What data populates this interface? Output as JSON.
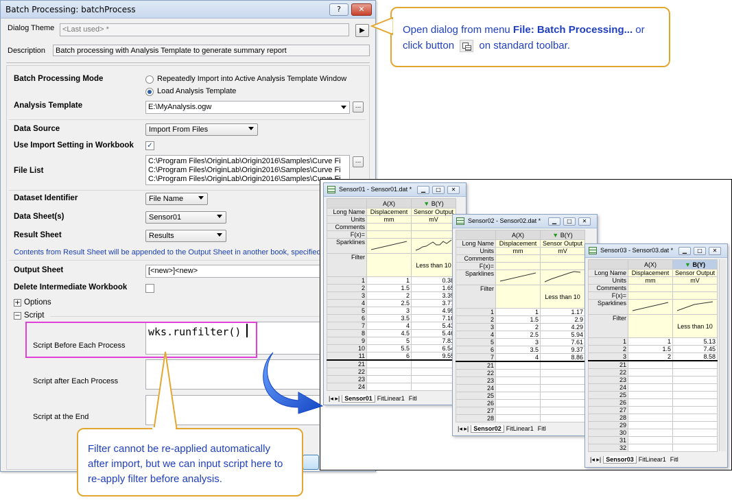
{
  "dialog": {
    "title": "Batch Processing: batchProcess",
    "help_btn": "?",
    "close_btn": "✕",
    "theme_label": "Dialog Theme",
    "theme_value": "<Last used> *",
    "description_label": "Description",
    "description_value": "Batch processing with Analysis Template to generate summary report",
    "mode_label": "Batch Processing Mode",
    "mode_opt1": "Repeatedly Import into Active Analysis Template Window",
    "mode_opt2": "Load Analysis Template",
    "template_label": "Analysis Template",
    "template_value": "E:\\MyAnalysis.ogw",
    "source_label": "Data Source",
    "source_value": "Import From Files",
    "import_setting_label": "Use Import Setting in Workbook",
    "filelist_label": "File List",
    "files": [
      "C:\\Program Files\\OriginLab\\Origin2016\\Samples\\Curve Fi",
      "C:\\Program Files\\OriginLab\\Origin2016\\Samples\\Curve Fi",
      "C:\\Program Files\\OriginLab\\Origin2016\\Samples\\Curve Fi"
    ],
    "dataset_id_label": "Dataset Identifier",
    "dataset_id_value": "File Name",
    "datasheet_label": "Data Sheet(s)",
    "datasheet_value": "Sensor01",
    "result_label": "Result Sheet",
    "result_value": "Results",
    "result_note": "Contents from Result Sheet will be appended to the Output Sheet in another book, specified be",
    "output_label": "Output Sheet",
    "output_value": "[<new>]<new>",
    "delete_label": "Delete Intermediate Workbook",
    "options_label": "Options",
    "script_label": "Script",
    "script_before_label": "Script Before Each Process",
    "script_before_value": "wks.runfilter()",
    "script_after_label": "Script after Each Process",
    "script_end_label": "Script at the End"
  },
  "callout_top": {
    "line1_pre": "Open dialog from menu ",
    "line1_bold": "File: Batch Processing...",
    "line1_post": " or",
    "line2_pre": "click button ",
    "line2_post": " on standard toolbar."
  },
  "callout_bottom": {
    "text": "Filter cannot be re-applied automatically after import, but we can input script here to re-apply filter before analysis."
  },
  "worksheets": [
    {
      "title": "Sensor01 - Sensor01.dat *",
      "filter_text": "Less than 10",
      "rows": [
        [
          "1",
          "1",
          "0.38"
        ],
        [
          "2",
          "1.5",
          "1.65"
        ],
        [
          "3",
          "2",
          "3.39"
        ],
        [
          "4",
          "2.5",
          "3.77"
        ],
        [
          "5",
          "3",
          "4.95"
        ],
        [
          "6",
          "3.5",
          "7.16"
        ],
        [
          "7",
          "4",
          "5.43"
        ],
        [
          "8",
          "4.5",
          "5.46"
        ],
        [
          "9",
          "5",
          "7.81"
        ],
        [
          "10",
          "5.5",
          "6.54"
        ],
        [
          "11",
          "6",
          "9.55"
        ]
      ],
      "empty_rows": [
        "21",
        "22",
        "23",
        "24"
      ],
      "tabs": [
        "Sensor01",
        "FitLinear1",
        "Fitl"
      ]
    },
    {
      "title": "Sensor02 - Sensor02.dat *",
      "filter_text": "Less than 10",
      "rows": [
        [
          "1",
          "1",
          "1.17"
        ],
        [
          "2",
          "1.5",
          "2.9"
        ],
        [
          "3",
          "2",
          "4.29"
        ],
        [
          "4",
          "2.5",
          "5.94"
        ],
        [
          "5",
          "3",
          "7.61"
        ],
        [
          "6",
          "3.5",
          "9.37"
        ],
        [
          "7",
          "4",
          "8.86"
        ]
      ],
      "empty_rows": [
        "21",
        "22",
        "23",
        "24",
        "25",
        "26",
        "27",
        "28"
      ],
      "tabs": [
        "Sensor02",
        "FitLinear1",
        "Fitl"
      ]
    },
    {
      "title": "Sensor03 - Sensor03.dat *",
      "filter_text": "Less than 10",
      "rows": [
        [
          "1",
          "1",
          "5.13"
        ],
        [
          "2",
          "1.5",
          "7.45"
        ],
        [
          "3",
          "2",
          "8.58"
        ]
      ],
      "empty_rows": [
        "21",
        "22",
        "23",
        "24",
        "25",
        "26",
        "27",
        "28",
        "29",
        "30",
        "31",
        "32"
      ],
      "tabs": [
        "Sensor03",
        "FitLinear1",
        "Fitl"
      ]
    }
  ],
  "sheet_headers": {
    "colA": "A(X)",
    "colB": "B(Y)",
    "long_name": "Long Name",
    "units": "Units",
    "comments": "Comments",
    "fx": "F(x)=",
    "sparklines": "Sparklines",
    "filter": "Filter",
    "a_long": "Displacement",
    "b_long": "Sensor Output",
    "a_unit": "mm",
    "b_unit": "mV"
  },
  "colors": {
    "callout_border": "#e3a72f",
    "callout_text": "#1f3fbf",
    "highlight_box": "#e040d8",
    "arrow": "#1e5fd8"
  }
}
